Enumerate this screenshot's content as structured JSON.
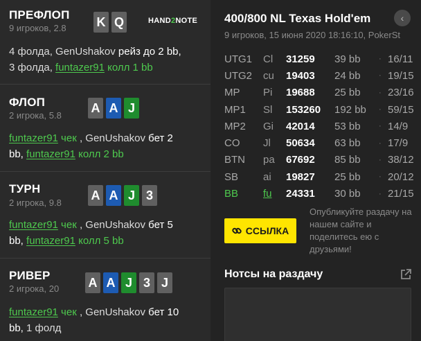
{
  "logo": {
    "a": "HAND",
    "b": "2",
    "c": "NOTE"
  },
  "streets": [
    {
      "title": "ПРЕФЛОП",
      "sub": "9 игроков, 2.8",
      "cards": [
        {
          "r": "K",
          "c": "#606060"
        },
        {
          "r": "Q",
          "c": "#606060"
        }
      ],
      "l1": "4 фолда, ",
      "l2": "GenUshakov",
      "l3": " рейз до 2 bb,",
      "l4": "3 фолда, ",
      "l5": "funtazer91",
      "l6": " колл 1 bb"
    },
    {
      "title": "ФЛОП",
      "sub": "2 игрока, 5.8",
      "cards": [
        {
          "r": "A",
          "c": "#606060"
        },
        {
          "r": "A",
          "c": "#1d5bb2"
        },
        {
          "r": "J",
          "c": "#1f8c2e"
        }
      ],
      "l1": "funtazer91",
      "l2": " чек",
      "l3": " , GenUshakov ",
      "l4": "бет 2",
      "l5": "bb, ",
      "l6": "funtazer91",
      "l7": " колл 2 bb"
    },
    {
      "title": "ТУРН",
      "sub": "2 игрока, 9.8",
      "cards": [
        {
          "r": "A",
          "c": "#606060"
        },
        {
          "r": "A",
          "c": "#1d5bb2"
        },
        {
          "r": "J",
          "c": "#1f8c2e"
        },
        {
          "r": "3",
          "c": "#606060"
        }
      ],
      "l1": "funtazer91",
      "l2": " чек",
      "l3": " , GenUshakov ",
      "l4": "бет 5",
      "l5": "bb, ",
      "l6": "funtazer91",
      "l7": " колл 5 bb"
    },
    {
      "title": "РИВЕР",
      "sub": "2 игрока, 20",
      "cards": [
        {
          "r": "A",
          "c": "#606060"
        },
        {
          "r": "A",
          "c": "#1d5bb2"
        },
        {
          "r": "J",
          "c": "#1f8c2e"
        },
        {
          "r": "3",
          "c": "#606060"
        },
        {
          "r": "J",
          "c": "#606060"
        }
      ],
      "l1": "funtazer91",
      "l2": " чек",
      "l3": " , GenUshakov ",
      "l4": "бет 10",
      "l5": "bb, ",
      "l6": "1 фолд"
    }
  ],
  "hand": {
    "title": "400/800 NL Texas Hold'em",
    "sub": "9 игроков, 15 июня 2020 18:16:10, PokerSt",
    "back_icon": "chevron-left-icon"
  },
  "players": [
    {
      "pos": "UTG1",
      "name": "Cl",
      "stack": "31259",
      "bb": "39 bb",
      "dot": "·",
      "stat": "16/11"
    },
    {
      "pos": "UTG2",
      "name": "cu",
      "stack": "19403",
      "bb": "24 bb",
      "dot": "·",
      "stat": "19/15"
    },
    {
      "pos": "MP",
      "name": "Pi",
      "stack": "19688",
      "bb": "25 bb",
      "dot": "·",
      "stat": "23/16"
    },
    {
      "pos": "MP1",
      "name": "Sl",
      "stack": "153260",
      "bb": "192 bb",
      "dot": "·",
      "stat": "59/15"
    },
    {
      "pos": "MP2",
      "name": "Gi",
      "stack": "42014",
      "bb": "53 bb",
      "dot": "·",
      "stat": "14/9"
    },
    {
      "pos": "CO",
      "name": "Jl",
      "stack": "50634",
      "bb": "63 bb",
      "dot": "·",
      "stat": "17/9"
    },
    {
      "pos": "BTN",
      "name": "pa",
      "stack": "67692",
      "bb": "85 bb",
      "dot": "·",
      "stat": "38/12"
    },
    {
      "pos": "SB",
      "name": "ai",
      "stack": "19827",
      "bb": "25 bb",
      "dot": "·",
      "stat": "20/12"
    },
    {
      "pos": "BB",
      "name": "fu",
      "stack": "24331",
      "bb": "30 bb",
      "dot": "·",
      "stat": "21/15",
      "hero": true
    }
  ],
  "share": {
    "button_label": "ССЫЛКА",
    "text": "Опубликуйте раздачу на нашем сайте и поделитесь ею с друзьями!"
  },
  "notes": {
    "title": "Нотсы на раздачу"
  },
  "colors": {
    "accent_green": "#4ec94e",
    "button_yellow": "#ffe500",
    "card_blue": "#1d5bb2",
    "card_green": "#1f8c2e",
    "card_gray": "#606060"
  }
}
